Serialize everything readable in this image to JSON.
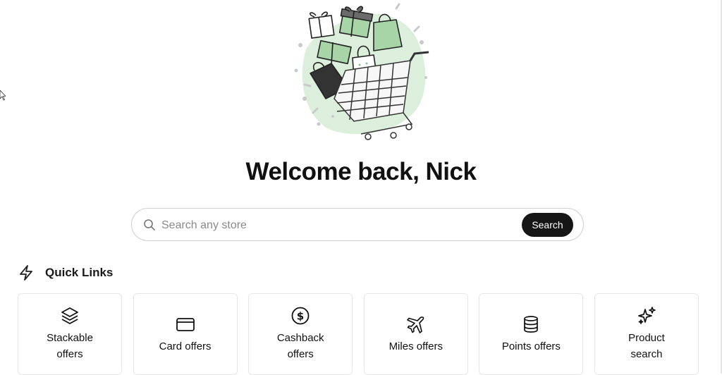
{
  "welcome": {
    "title": "Welcome back, Nick"
  },
  "search": {
    "placeholder": "Search any store",
    "button_label": "Search"
  },
  "quick_links": {
    "title": "Quick Links",
    "icon": "lightning-icon",
    "items": [
      {
        "label": "Stackable offers",
        "icon": "layers-icon"
      },
      {
        "label": "Card offers",
        "icon": "credit-card-icon"
      },
      {
        "label": "Cashback offers",
        "icon": "dollar-circle-icon"
      },
      {
        "label": "Miles offers",
        "icon": "airplane-icon"
      },
      {
        "label": "Points offers",
        "icon": "coins-stack-icon"
      },
      {
        "label": "Product search",
        "icon": "sparkle-icon"
      }
    ]
  },
  "colors": {
    "accent_green": "#b9dcbc",
    "button_dark": "#161616",
    "text": "#111111"
  }
}
